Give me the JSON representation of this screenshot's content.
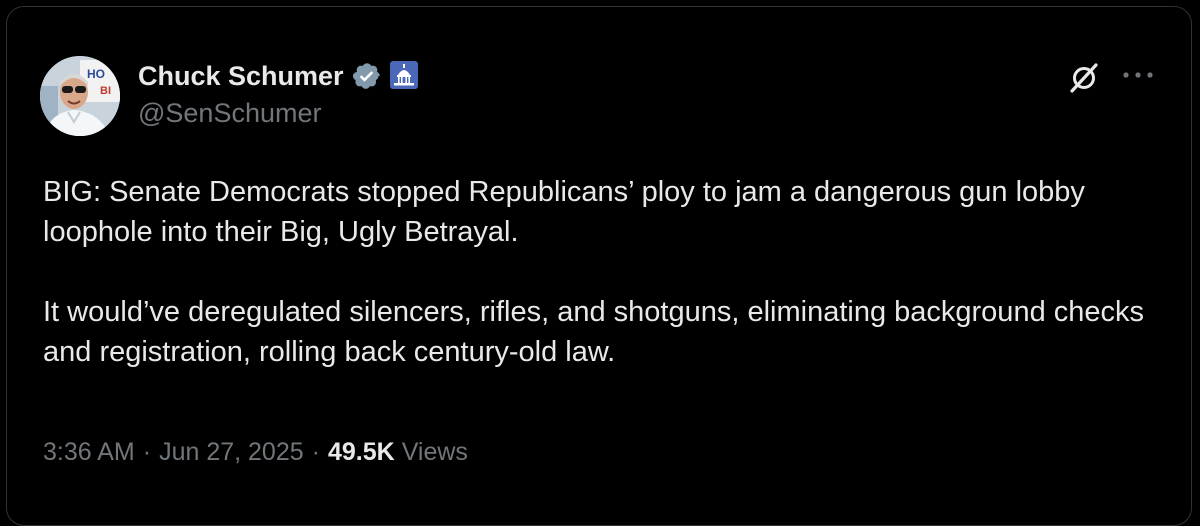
{
  "tweet": {
    "author": {
      "display_name": "Chuck Schumer",
      "handle": "@SenSchumer",
      "verified_icon": "verified-badge-icon",
      "affiliation_icon": "capitol-building-icon",
      "avatar_sign_text": "HO BI"
    },
    "actions": {
      "grok_icon": "grok-icon",
      "more_icon": "more-horizontal-icon"
    },
    "text": {
      "paragraph_1": "BIG: Senate Democrats stopped Republicans’ ploy to jam a dangerous gun lobby loophole into their Big, Ugly Betrayal.",
      "paragraph_2": "It would’ve deregulated silencers, rifles, and shotguns, eliminating background checks and registration, rolling back century-old law."
    },
    "meta": {
      "time": "3:36 AM",
      "separator": "·",
      "date": "Jun 27, 2025",
      "views_count": "49.5K",
      "views_label": "Views"
    }
  },
  "colors": {
    "background": "#000000",
    "text_primary": "#e7e9ea",
    "text_secondary": "#71767b",
    "verified_badge": "#829aab",
    "affiliation_bg": "#4a67b8"
  }
}
